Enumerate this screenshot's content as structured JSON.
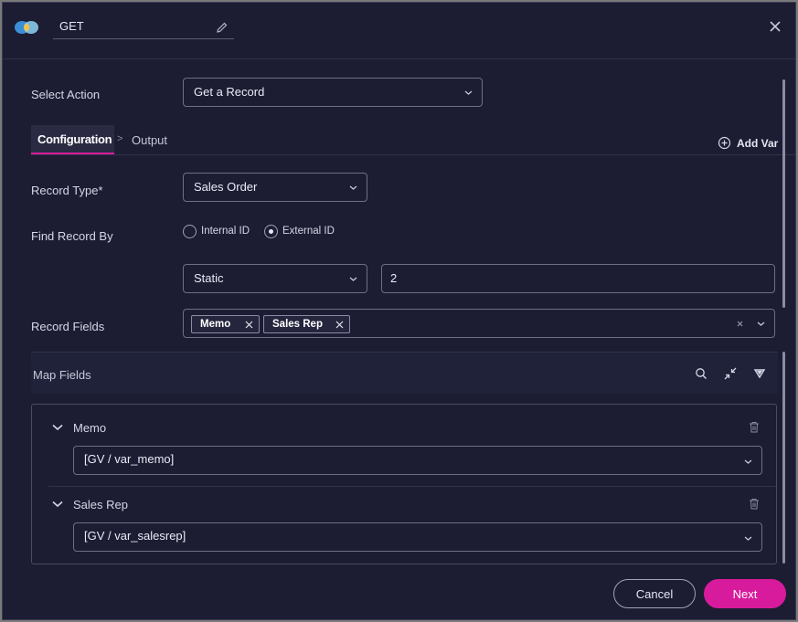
{
  "header": {
    "name_value": "GET"
  },
  "select_action": {
    "label": "Select Action",
    "value": "Get a Record"
  },
  "tabs": {
    "configuration": "Configuration",
    "separator": ">",
    "output": "Output",
    "add_var": "Add Var"
  },
  "record_type": {
    "label": "Record Type*",
    "value": "Sales Order"
  },
  "find_record_by": {
    "label": "Find Record By",
    "options": [
      "Internal ID",
      "External ID"
    ],
    "selected": "External ID",
    "mode_value": "Static",
    "id_value": "2"
  },
  "record_fields": {
    "label": "Record Fields",
    "chips": [
      "Memo",
      "Sales Rep"
    ]
  },
  "map_fields": {
    "title": "Map Fields",
    "rows": [
      {
        "name": "Memo",
        "value": "[GV / var_memo]"
      },
      {
        "name": "Sales Rep",
        "value": "[GV / var_salesrep]"
      }
    ]
  },
  "footer": {
    "cancel": "Cancel",
    "next": "Next"
  },
  "colors": {
    "background": "#1c1d33",
    "accent": "#d81b9c"
  },
  "icons": [
    "logo-icon",
    "pencil-icon",
    "close-icon",
    "chevron-down-icon",
    "add-circle-icon",
    "search-icon",
    "collapse-icon",
    "filter-icon",
    "trash-icon"
  ]
}
